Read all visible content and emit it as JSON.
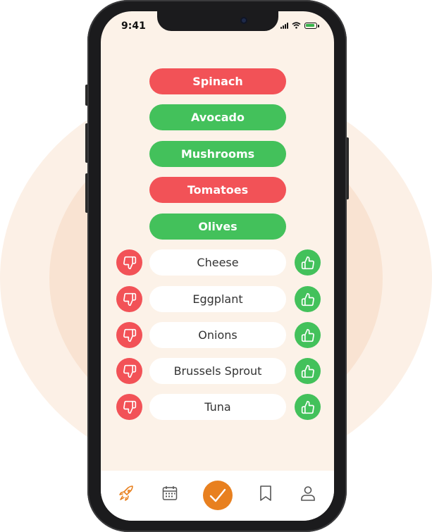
{
  "status_bar": {
    "time": "9:41"
  },
  "voted_items": [
    {
      "label": "Spinach",
      "vote": "dislike"
    },
    {
      "label": "Avocado",
      "vote": "like"
    },
    {
      "label": "Mushrooms",
      "vote": "like"
    },
    {
      "label": "Tomatoes",
      "vote": "dislike"
    },
    {
      "label": "Olives",
      "vote": "like"
    }
  ],
  "pending_items": [
    {
      "label": "Cheese"
    },
    {
      "label": "Eggplant"
    },
    {
      "label": "Onions"
    },
    {
      "label": "Brussels Sprout"
    },
    {
      "label": "Tuna"
    }
  ],
  "colors": {
    "like": "#43c15b",
    "dislike": "#f25257",
    "accent": "#e8801f",
    "screen_bg": "#fcf2e8"
  },
  "bottom_nav": {
    "items": [
      {
        "icon": "rocket-icon",
        "active": true
      },
      {
        "icon": "calendar-icon",
        "active": false
      },
      {
        "icon": "check-icon",
        "active": false
      },
      {
        "icon": "bookmark-icon",
        "active": false
      },
      {
        "icon": "user-icon",
        "active": false
      }
    ]
  }
}
